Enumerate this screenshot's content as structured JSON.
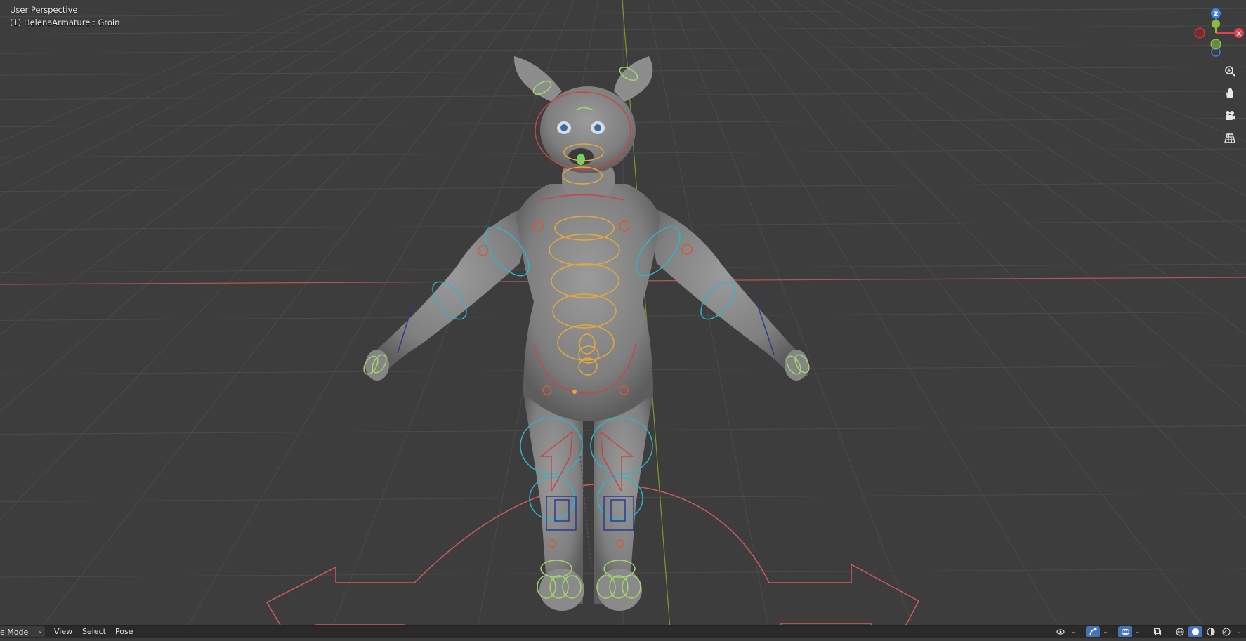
{
  "viewport": {
    "view_name": "User Perspective",
    "active_object": "(1) HelenaArmature : Groin"
  },
  "gizmo": {
    "axis_z": "Z",
    "axis_x": "X",
    "colors": {
      "x": "#e0414f",
      "y": "#8bbd3a",
      "z": "#3d83e6"
    }
  },
  "navigation": {
    "items": [
      {
        "name": "zoom-icon"
      },
      {
        "name": "hand-pan-icon"
      },
      {
        "name": "camera-icon"
      },
      {
        "name": "grid-view-icon"
      }
    ]
  },
  "footer": {
    "mode_label": "e Mode",
    "menus": [
      "View",
      "Select",
      "Pose"
    ]
  },
  "colors": {
    "background": "#3d3d3d",
    "grid": "#4a4a4a",
    "x_axis": "#b8545b",
    "y_axis": "#7a9b2a",
    "bone_yellow": "#e5a83a",
    "bone_cyan": "#2fb5c9",
    "bone_red": "#c84545",
    "bone_green": "#9fd86a",
    "bone_blue": "#2c3990"
  }
}
